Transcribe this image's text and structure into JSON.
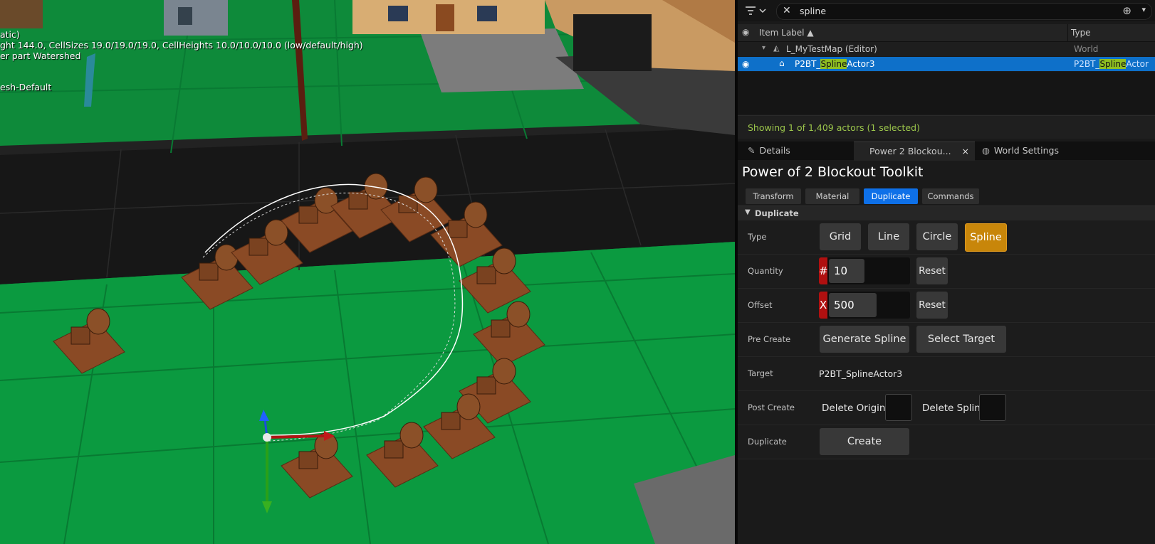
{
  "viewport": {
    "stats_lines": [
      "atic)",
      "ght 144.0, CellSizes 19.0/19.0/19.0, CellHeights 10.0/10.0/10.0 (low/default/high)",
      "er part Watershed",
      "esh-Default"
    ]
  },
  "outliner": {
    "search_value": "spline",
    "col_label": "Item Label",
    "col_type": "Type",
    "world_row": {
      "label": "L_MyTestMap (Editor)",
      "type": "World"
    },
    "actor_row": {
      "label_pre": "P2BT_",
      "label_hl": "Spline",
      "label_post": "Actor3",
      "type_pre": "P2BT_",
      "type_hl": "Spline",
      "type_post": "Actor"
    },
    "status": "Showing 1 of 1,409 actors (1 selected)"
  },
  "tabs": {
    "details": "Details",
    "toolkit": "Power 2 Blockou...",
    "world_settings": "World Settings"
  },
  "toolkit": {
    "title": "Power of 2 Blockout Toolkit",
    "mode_buttons": [
      "Transform",
      "Material",
      "Duplicate",
      "Commands"
    ],
    "active_mode": "Duplicate",
    "section": "Duplicate",
    "type_label": "Type",
    "type_options": [
      "Grid",
      "Line",
      "Circle",
      "Spline"
    ],
    "type_selected": "Spline",
    "quantity_label": "Quantity",
    "quantity_tag": "#",
    "quantity_value": "10",
    "offset_label": "Offset",
    "offset_tag": "X",
    "offset_value": "500",
    "reset": "Reset",
    "pre_create_label": "Pre Create",
    "generate_spline": "Generate Spline",
    "select_target": "Select Target",
    "target_label": "Target",
    "target_value": "P2BT_SplineActor3",
    "post_create_label": "Post Create",
    "delete_original": "Delete Original",
    "delete_spline": "Delete Spline",
    "duplicate_label": "Duplicate",
    "create": "Create"
  },
  "colors": {
    "accent_blue": "#0e70c9",
    "selected_orange": "#c8860a",
    "search_highlight": "#8fbf22",
    "status_green": "#9bc54b"
  }
}
